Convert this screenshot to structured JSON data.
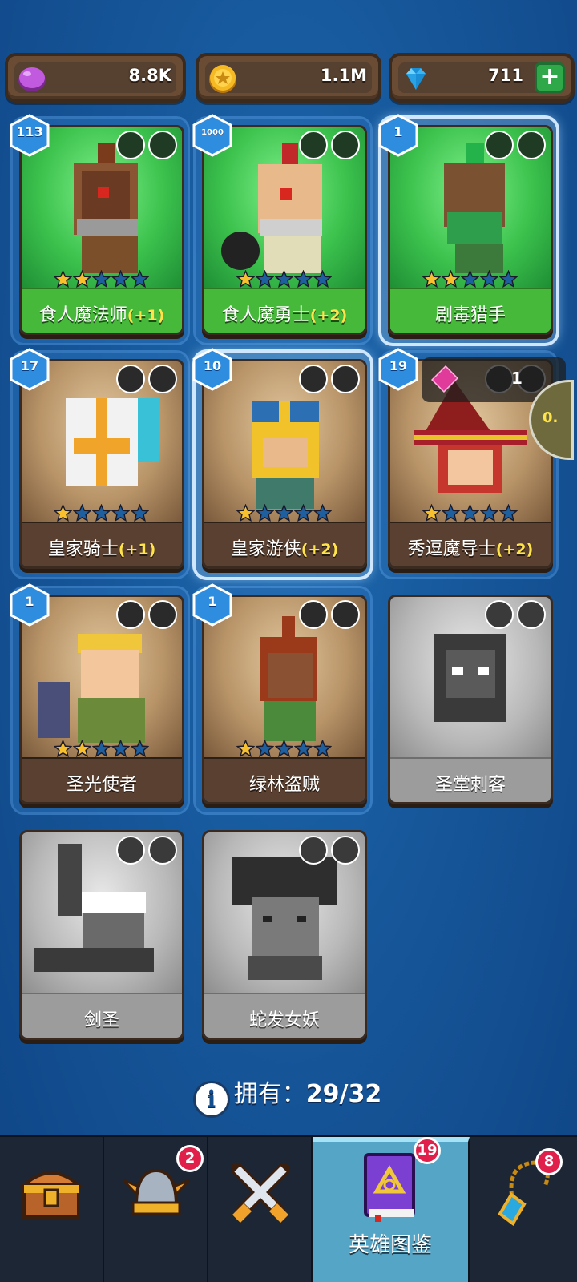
{
  "currency": {
    "elixir": {
      "value": "8.8K",
      "icon": "purple-elixir-icon",
      "color": "#b14bd1"
    },
    "gold": {
      "value": "1.1M",
      "icon": "gold-coin-icon",
      "color": "#f4b31f"
    },
    "gems": {
      "value": "711",
      "icon": "blue-gem-icon",
      "plus": "+",
      "color": "#2ea8e8"
    }
  },
  "heroes": [
    {
      "name": "食人魔法师",
      "bonus": "(+1)",
      "level": "113",
      "stars": 2,
      "traits": [
        "ogre-icon",
        "dagger-icon"
      ],
      "theme": "green"
    },
    {
      "name": "食人魔勇士",
      "bonus": "(+2)",
      "level": "1000",
      "stars": 1,
      "traits": [
        "ogre-icon",
        "sword-icon"
      ],
      "theme": "green"
    },
    {
      "name": "剧毒猎手",
      "bonus": "",
      "level": "1",
      "stars": 2,
      "traits": [
        "ogre-icon",
        "bow-icon"
      ],
      "theme": "green"
    },
    {
      "name": "皇家骑士",
      "bonus": "(+1)",
      "level": "17",
      "stars": 1,
      "traits": [
        "helmet-icon",
        "sword-icon"
      ],
      "theme": "tan"
    },
    {
      "name": "皇家游侠",
      "bonus": "(+2)",
      "level": "10",
      "stars": 1,
      "traits": [
        "helmet-icon",
        "bow-icon"
      ],
      "theme": "tan"
    },
    {
      "name": "秀逗魔导士",
      "bonus": "(+2)",
      "level": "19",
      "stars": 1,
      "traits": [
        "helmet-icon",
        "staff-icon"
      ],
      "theme": "tan"
    },
    {
      "name": "圣光使者",
      "bonus": "",
      "level": "1",
      "stars": 2,
      "traits": [
        "helmet-icon",
        "hammer-icon"
      ],
      "theme": "tan"
    },
    {
      "name": "绿林盗贼",
      "bonus": "",
      "level": "1",
      "stars": 1,
      "traits": [
        "helmet-icon",
        "dagger-icon"
      ],
      "theme": "tan"
    },
    {
      "name": "圣堂刺客",
      "bonus": "",
      "level": "",
      "stars": 0,
      "traits": [
        "winged-crest-icon",
        "dagger-icon"
      ],
      "theme": "gray"
    },
    {
      "name": "剑圣",
      "bonus": "",
      "level": "",
      "stars": 0,
      "traits": [
        "ogre-icon",
        "sword-icon"
      ],
      "theme": "gray"
    },
    {
      "name": "蛇发女妖",
      "bonus": "",
      "level": "",
      "stars": 0,
      "traits": [
        "demon-icon",
        "bow-icon"
      ],
      "theme": "gray"
    }
  ],
  "overlay": {
    "level_text": "1",
    "zoom_text": "0."
  },
  "owned": {
    "label": "拥有：",
    "count": "29/32",
    "info": "i"
  },
  "nav": {
    "items": [
      {
        "icon": "treasure-chest-icon",
        "badge": ""
      },
      {
        "icon": "winged-helmet-icon",
        "badge": "2"
      },
      {
        "icon": "crossed-swords-icon",
        "badge": ""
      },
      {
        "icon": "hero-book-icon",
        "badge": "19",
        "label": "英雄图鉴",
        "active": true
      },
      {
        "icon": "amulet-icon",
        "badge": "8"
      }
    ]
  },
  "colors": {
    "accent_star": "#f7c02c",
    "empty_star": "#1e5fa0",
    "level_badge": "#2f8de0",
    "bonus": "#ffe34a"
  }
}
